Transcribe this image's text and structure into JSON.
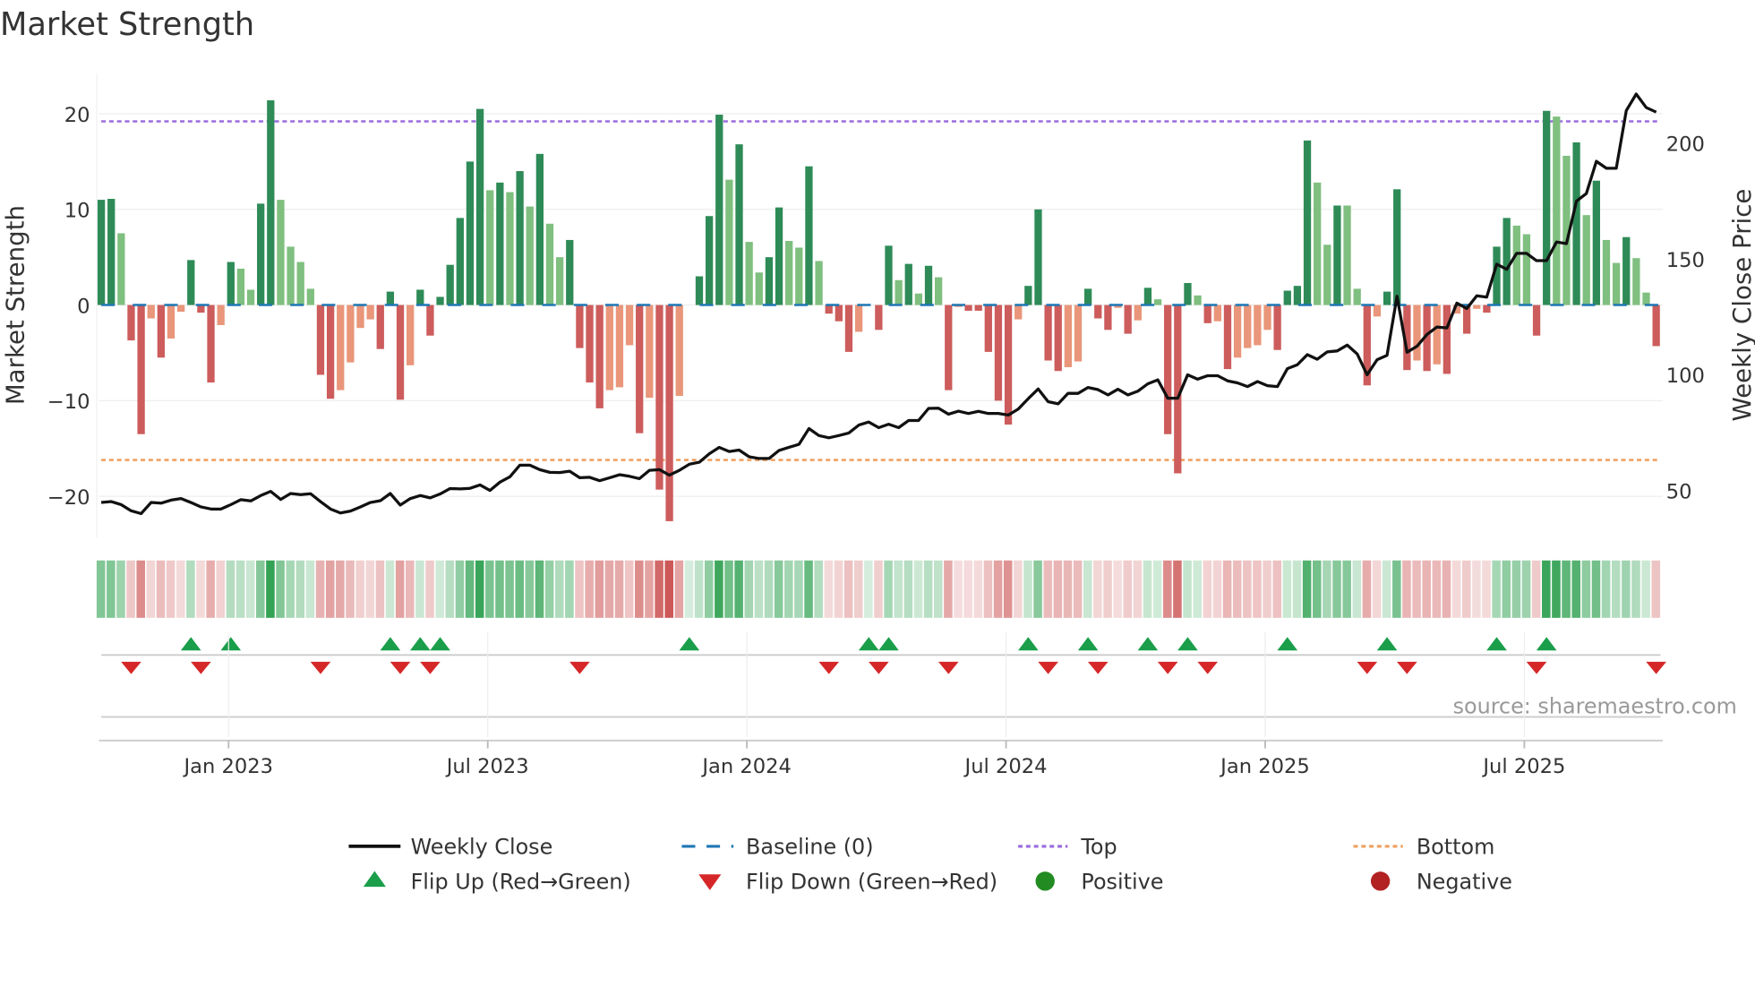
{
  "title": "Market Strength",
  "source": "source: sharemaestro.com",
  "colors": {
    "pos_strong": "#2e8b57",
    "pos_weak": "#7fbf7f",
    "neg_strong": "#cd5c5c",
    "neg_weak": "#e9967a",
    "price": "#111111",
    "baseline": "#1f77b4",
    "top": "#9b6bde",
    "bottom": "#f0a060",
    "flip_up": "#1a9e4a",
    "flip_down": "#d62728",
    "positive": "#228b22",
    "negative": "#b22222"
  },
  "chart_data": {
    "type": "bar",
    "title": "Market Strength",
    "ylabel": "Market Strength",
    "y2label": "Weekly Close Price",
    "ylim": [
      -24.5,
      24.5
    ],
    "y2lim": [
      30,
      230
    ],
    "yticks": [
      "−20",
      "−10",
      "0",
      "10",
      "20"
    ],
    "ytick_values": [
      -20,
      -10,
      0,
      10,
      20
    ],
    "y2ticks": [
      "50",
      "100",
      "150",
      "200"
    ],
    "y2tick_values": [
      50,
      100,
      150,
      200
    ],
    "xticks": [
      "Jan 2023",
      "Jul 2023",
      "Jan 2024",
      "Jul 2024",
      "Jan 2025",
      "Jul 2025"
    ],
    "xtick_week_index": [
      13,
      39,
      65,
      91,
      117,
      143
    ],
    "frequency": "weekly",
    "top_level": 19.2,
    "bottom_level": -16.2,
    "baseline": 0,
    "strength": [
      11,
      11.1,
      7.5,
      -3.7,
      -13.5,
      -1.4,
      -5.5,
      -3.5,
      -0.7,
      4.7,
      -0.8,
      -8.1,
      -2.1,
      4.5,
      3.8,
      1.6,
      10.6,
      21.4,
      11,
      6.1,
      4.5,
      1.7,
      -7.3,
      -9.8,
      -8.9,
      -6,
      -2.4,
      -1.5,
      -4.6,
      1.4,
      -9.9,
      -6.3,
      1.6,
      -3.2,
      0.85,
      4.2,
      9.1,
      15,
      20.5,
      12,
      12.8,
      11.8,
      14,
      10.3,
      15.8,
      8.5,
      5,
      6.8,
      -4.5,
      -8.1,
      -10.8,
      -8.9,
      -8.6,
      -4.2,
      -13.4,
      -9.7,
      -19.3,
      -22.6,
      -9.5,
      0,
      3,
      9.3,
      19.9,
      13.1,
      16.8,
      6.6,
      3.4,
      5,
      10.2,
      6.7,
      6,
      14.5,
      4.6,
      -0.9,
      -1.7,
      -4.9,
      -2.8,
      0,
      -2.6,
      6.2,
      2.6,
      4.3,
      1.2,
      4.1,
      2.9,
      -8.9,
      -0.2,
      -0.6,
      -0.6,
      -4.9,
      -10,
      -12.5,
      -1.5,
      2,
      10,
      -5.8,
      -6.9,
      -6.5,
      -5.9,
      1.7,
      -1.4,
      -2.6,
      -0.3,
      -3,
      -1.6,
      1.8,
      0.6,
      -13.5,
      -17.6,
      2.3,
      1,
      -1.9,
      -1.7,
      -6.7,
      -5.5,
      -4.5,
      -4.2,
      -2.6,
      -4.7,
      1.5,
      2,
      17.2,
      12.8,
      6.3,
      10.4,
      10.4,
      1.7,
      -8.4,
      -1.2,
      1.4,
      12.1,
      -6.8,
      -5.8,
      -6.9,
      -6.2,
      -7.2,
      -0.9,
      -3,
      -0.4,
      -0.8,
      6.1,
      9.1,
      8.3,
      7.4,
      -3.2,
      20.3,
      19.7,
      15.6,
      17,
      9.4,
      13,
      6.8,
      4.4,
      7.1,
      4.9,
      1.3,
      -4.3
    ],
    "strength_shade": "DDLDDLDLLDDDLDLLDDLLLLDDLLLLDDDLDDDDDDDLDLDLDLLDDDDLLLDLDDLDDDDLDLLDDLLDLDDDLDDDLDLDLDLDDDDDLDDDDLLDDDLDLDLDDDLDLDLLLLDDDDLLDLLDLDDDLDLDLDLDDDLLDDLLDLDLLDLLD",
    "weekly_close": [
      44.9,
      45.3,
      44,
      41.3,
      40.1,
      44.9,
      44.6,
      45.9,
      46.6,
      44.9,
      43,
      42.1,
      42.1,
      44,
      46.1,
      45.6,
      47.9,
      49.7,
      46.2,
      48.8,
      48.3,
      48.7,
      45.3,
      42.1,
      40.4,
      41.2,
      43,
      44.9,
      45.7,
      48.8,
      43.8,
      46.6,
      47.9,
      46.9,
      48.6,
      50.9,
      50.8,
      51,
      52.5,
      50.1,
      53.7,
      56,
      61,
      61,
      59.1,
      57.9,
      57.8,
      58.4,
      55.6,
      55.8,
      54.3,
      55.6,
      56.9,
      56.2,
      55.2,
      58.8,
      59.1,
      56.7,
      58.8,
      61.4,
      62.3,
      65.9,
      68.7,
      66.9,
      67.5,
      64.6,
      63.9,
      63.9,
      67.4,
      68.7,
      70,
      76.8,
      73.8,
      72.8,
      73.8,
      74.9,
      78.3,
      79.6,
      77.2,
      78.7,
      77.2,
      80.3,
      80.3,
      85.5,
      85.6,
      83,
      84.3,
      83.3,
      84.2,
      83.3,
      83.3,
      82.6,
      85.2,
      89.7,
      93.9,
      88.4,
      87.5,
      92,
      92,
      94.5,
      93.6,
      91.3,
      93.8,
      91.3,
      92.9,
      96.1,
      97.8,
      89.9,
      89.9,
      100,
      98.1,
      99.6,
      99.6,
      97.4,
      96.5,
      94.9,
      97.1,
      95.3,
      94.9,
      102.6,
      104.3,
      108.7,
      106.7,
      109.9,
      110.3,
      112.8,
      109,
      100,
      106.5,
      108.4,
      133.9,
      109.7,
      112.3,
      117.4,
      120.6,
      120.2,
      130.9,
      128.6,
      134.1,
      133.5,
      147.7,
      145.5,
      152.4,
      152.4,
      149.2,
      149.2,
      157.3,
      156.6,
      174.9,
      178.2,
      192.1,
      189.1,
      189.1,
      214,
      221.1,
      215.3,
      213.3
    ],
    "legend": {
      "placement": "bottom",
      "weekly_close": "Weekly Close",
      "baseline": "Baseline (0)",
      "top": "Top",
      "bottom": "Bottom",
      "flip_up": "Flip Up (Red→Green)",
      "flip_down": "Flip Down (Green→Red)",
      "positive": "Positive",
      "negative": "Negative"
    }
  }
}
